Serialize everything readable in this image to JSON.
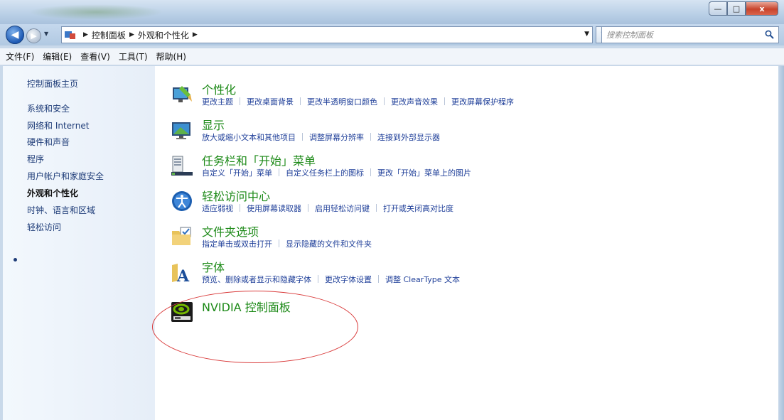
{
  "window": {
    "close_glyph": "x",
    "min_glyph": "—",
    "max_glyph": "□"
  },
  "address": {
    "crumbs": [
      "控制面板",
      "外观和个性化"
    ],
    "search_placeholder": "搜索控制面板"
  },
  "menu": [
    "文件(F)",
    "编辑(E)",
    "查看(V)",
    "工具(T)",
    "帮助(H)"
  ],
  "sidebar": {
    "items": [
      {
        "label": "控制面板主页"
      },
      {
        "label": "系统和安全"
      },
      {
        "label": "网络和 Internet"
      },
      {
        "label": "硬件和声音"
      },
      {
        "label": "程序"
      },
      {
        "label": "用户帐户和家庭安全"
      },
      {
        "label": "外观和个性化"
      },
      {
        "label": "时钟、语言和区域"
      },
      {
        "label": "轻松访问"
      }
    ]
  },
  "categories": [
    {
      "title": "个性化",
      "icon": "personalization-icon",
      "links": [
        "更改主题",
        "更改桌面背景",
        "更改半透明窗口颜色",
        "更改声音效果",
        "更改屏幕保护程序"
      ]
    },
    {
      "title": "显示",
      "icon": "display-icon",
      "links": [
        "放大或缩小文本和其他项目",
        "调整屏幕分辨率",
        "连接到外部显示器"
      ]
    },
    {
      "title": "任务栏和「开始」菜单",
      "icon": "taskbar-icon",
      "links": [
        "自定义「开始」菜单",
        "自定义任务栏上的图标",
        "更改「开始」菜单上的图片"
      ]
    },
    {
      "title": "轻松访问中心",
      "icon": "ease-of-access-icon",
      "links": [
        "适应弱视",
        "使用屏幕读取器",
        "启用轻松访问键",
        "打开或关闭高对比度"
      ]
    },
    {
      "title": "文件夹选项",
      "icon": "folder-options-icon",
      "links": [
        "指定单击或双击打开",
        "显示隐藏的文件和文件夹"
      ]
    },
    {
      "title": "字体",
      "icon": "fonts-icon",
      "links": [
        "预览、删除或者显示和隐藏字体",
        "更改字体设置",
        "调整 ClearType 文本"
      ]
    },
    {
      "title": "NVIDIA 控制面板",
      "icon": "nvidia-icon",
      "links": []
    }
  ]
}
